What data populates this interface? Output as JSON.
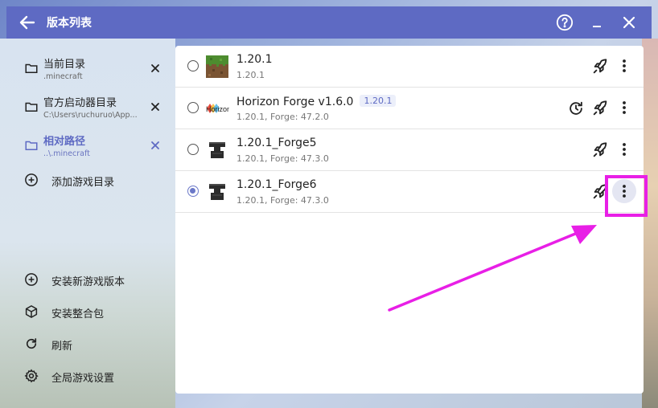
{
  "window": {
    "title": "版本列表"
  },
  "sidebar": {
    "folders": [
      {
        "label": "当前目录",
        "path": ".minecraft",
        "active": false
      },
      {
        "label": "官方启动器目录",
        "path": "C:\\Users\\ruchuruo\\App...",
        "active": false
      },
      {
        "label": "相对路径",
        "path": "..\\.minecraft",
        "active": true
      }
    ],
    "add_folder_label": "添加游戏目录",
    "actions": [
      {
        "label": "安装新游戏版本",
        "icon": "plus-circle-icon"
      },
      {
        "label": "安装整合包",
        "icon": "package-icon"
      },
      {
        "label": "刷新",
        "icon": "refresh-icon"
      },
      {
        "label": "全局游戏设置",
        "icon": "gear-icon"
      }
    ]
  },
  "versions": [
    {
      "name": "1.20.1",
      "tag": "",
      "detail": "1.20.1",
      "icon": "grass-block-icon",
      "selected": false
    },
    {
      "name": "Horizon Forge v1.6.0",
      "tag": "1.20.1",
      "detail": "1.20.1, Forge: 47.2.0",
      "icon": "horizon-logo",
      "selected": false
    },
    {
      "name": "1.20.1_Forge5",
      "tag": "",
      "detail": "1.20.1, Forge: 47.3.0",
      "icon": "anvil-icon",
      "selected": false
    },
    {
      "name": "1.20.1_Forge6",
      "tag": "",
      "detail": "1.20.1, Forge: 47.3.0",
      "icon": "anvil-icon",
      "selected": true
    }
  ],
  "colors": {
    "accent": "#5e6ac3",
    "highlight": "#e81fe6"
  }
}
